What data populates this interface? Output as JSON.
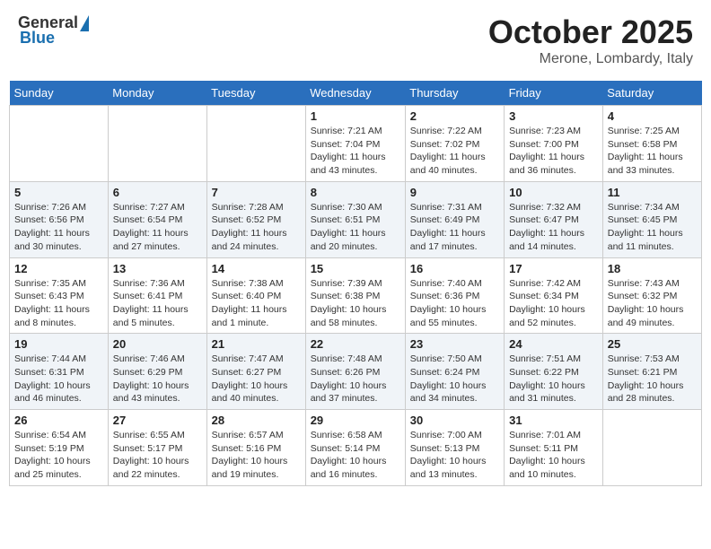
{
  "header": {
    "logo_general": "General",
    "logo_blue": "Blue",
    "month_title": "October 2025",
    "location": "Merone, Lombardy, Italy"
  },
  "days_of_week": [
    "Sunday",
    "Monday",
    "Tuesday",
    "Wednesday",
    "Thursday",
    "Friday",
    "Saturday"
  ],
  "weeks": [
    [
      {
        "day": "",
        "sunrise": "",
        "sunset": "",
        "daylight": ""
      },
      {
        "day": "",
        "sunrise": "",
        "sunset": "",
        "daylight": ""
      },
      {
        "day": "",
        "sunrise": "",
        "sunset": "",
        "daylight": ""
      },
      {
        "day": "1",
        "sunrise": "Sunrise: 7:21 AM",
        "sunset": "Sunset: 7:04 PM",
        "daylight": "Daylight: 11 hours and 43 minutes."
      },
      {
        "day": "2",
        "sunrise": "Sunrise: 7:22 AM",
        "sunset": "Sunset: 7:02 PM",
        "daylight": "Daylight: 11 hours and 40 minutes."
      },
      {
        "day": "3",
        "sunrise": "Sunrise: 7:23 AM",
        "sunset": "Sunset: 7:00 PM",
        "daylight": "Daylight: 11 hours and 36 minutes."
      },
      {
        "day": "4",
        "sunrise": "Sunrise: 7:25 AM",
        "sunset": "Sunset: 6:58 PM",
        "daylight": "Daylight: 11 hours and 33 minutes."
      }
    ],
    [
      {
        "day": "5",
        "sunrise": "Sunrise: 7:26 AM",
        "sunset": "Sunset: 6:56 PM",
        "daylight": "Daylight: 11 hours and 30 minutes."
      },
      {
        "day": "6",
        "sunrise": "Sunrise: 7:27 AM",
        "sunset": "Sunset: 6:54 PM",
        "daylight": "Daylight: 11 hours and 27 minutes."
      },
      {
        "day": "7",
        "sunrise": "Sunrise: 7:28 AM",
        "sunset": "Sunset: 6:52 PM",
        "daylight": "Daylight: 11 hours and 24 minutes."
      },
      {
        "day": "8",
        "sunrise": "Sunrise: 7:30 AM",
        "sunset": "Sunset: 6:51 PM",
        "daylight": "Daylight: 11 hours and 20 minutes."
      },
      {
        "day": "9",
        "sunrise": "Sunrise: 7:31 AM",
        "sunset": "Sunset: 6:49 PM",
        "daylight": "Daylight: 11 hours and 17 minutes."
      },
      {
        "day": "10",
        "sunrise": "Sunrise: 7:32 AM",
        "sunset": "Sunset: 6:47 PM",
        "daylight": "Daylight: 11 hours and 14 minutes."
      },
      {
        "day": "11",
        "sunrise": "Sunrise: 7:34 AM",
        "sunset": "Sunset: 6:45 PM",
        "daylight": "Daylight: 11 hours and 11 minutes."
      }
    ],
    [
      {
        "day": "12",
        "sunrise": "Sunrise: 7:35 AM",
        "sunset": "Sunset: 6:43 PM",
        "daylight": "Daylight: 11 hours and 8 minutes."
      },
      {
        "day": "13",
        "sunrise": "Sunrise: 7:36 AM",
        "sunset": "Sunset: 6:41 PM",
        "daylight": "Daylight: 11 hours and 5 minutes."
      },
      {
        "day": "14",
        "sunrise": "Sunrise: 7:38 AM",
        "sunset": "Sunset: 6:40 PM",
        "daylight": "Daylight: 11 hours and 1 minute."
      },
      {
        "day": "15",
        "sunrise": "Sunrise: 7:39 AM",
        "sunset": "Sunset: 6:38 PM",
        "daylight": "Daylight: 10 hours and 58 minutes."
      },
      {
        "day": "16",
        "sunrise": "Sunrise: 7:40 AM",
        "sunset": "Sunset: 6:36 PM",
        "daylight": "Daylight: 10 hours and 55 minutes."
      },
      {
        "day": "17",
        "sunrise": "Sunrise: 7:42 AM",
        "sunset": "Sunset: 6:34 PM",
        "daylight": "Daylight: 10 hours and 52 minutes."
      },
      {
        "day": "18",
        "sunrise": "Sunrise: 7:43 AM",
        "sunset": "Sunset: 6:32 PM",
        "daylight": "Daylight: 10 hours and 49 minutes."
      }
    ],
    [
      {
        "day": "19",
        "sunrise": "Sunrise: 7:44 AM",
        "sunset": "Sunset: 6:31 PM",
        "daylight": "Daylight: 10 hours and 46 minutes."
      },
      {
        "day": "20",
        "sunrise": "Sunrise: 7:46 AM",
        "sunset": "Sunset: 6:29 PM",
        "daylight": "Daylight: 10 hours and 43 minutes."
      },
      {
        "day": "21",
        "sunrise": "Sunrise: 7:47 AM",
        "sunset": "Sunset: 6:27 PM",
        "daylight": "Daylight: 10 hours and 40 minutes."
      },
      {
        "day": "22",
        "sunrise": "Sunrise: 7:48 AM",
        "sunset": "Sunset: 6:26 PM",
        "daylight": "Daylight: 10 hours and 37 minutes."
      },
      {
        "day": "23",
        "sunrise": "Sunrise: 7:50 AM",
        "sunset": "Sunset: 6:24 PM",
        "daylight": "Daylight: 10 hours and 34 minutes."
      },
      {
        "day": "24",
        "sunrise": "Sunrise: 7:51 AM",
        "sunset": "Sunset: 6:22 PM",
        "daylight": "Daylight: 10 hours and 31 minutes."
      },
      {
        "day": "25",
        "sunrise": "Sunrise: 7:53 AM",
        "sunset": "Sunset: 6:21 PM",
        "daylight": "Daylight: 10 hours and 28 minutes."
      }
    ],
    [
      {
        "day": "26",
        "sunrise": "Sunrise: 6:54 AM",
        "sunset": "Sunset: 5:19 PM",
        "daylight": "Daylight: 10 hours and 25 minutes."
      },
      {
        "day": "27",
        "sunrise": "Sunrise: 6:55 AM",
        "sunset": "Sunset: 5:17 PM",
        "daylight": "Daylight: 10 hours and 22 minutes."
      },
      {
        "day": "28",
        "sunrise": "Sunrise: 6:57 AM",
        "sunset": "Sunset: 5:16 PM",
        "daylight": "Daylight: 10 hours and 19 minutes."
      },
      {
        "day": "29",
        "sunrise": "Sunrise: 6:58 AM",
        "sunset": "Sunset: 5:14 PM",
        "daylight": "Daylight: 10 hours and 16 minutes."
      },
      {
        "day": "30",
        "sunrise": "Sunrise: 7:00 AM",
        "sunset": "Sunset: 5:13 PM",
        "daylight": "Daylight: 10 hours and 13 minutes."
      },
      {
        "day": "31",
        "sunrise": "Sunrise: 7:01 AM",
        "sunset": "Sunset: 5:11 PM",
        "daylight": "Daylight: 10 hours and 10 minutes."
      },
      {
        "day": "",
        "sunrise": "",
        "sunset": "",
        "daylight": ""
      }
    ]
  ]
}
